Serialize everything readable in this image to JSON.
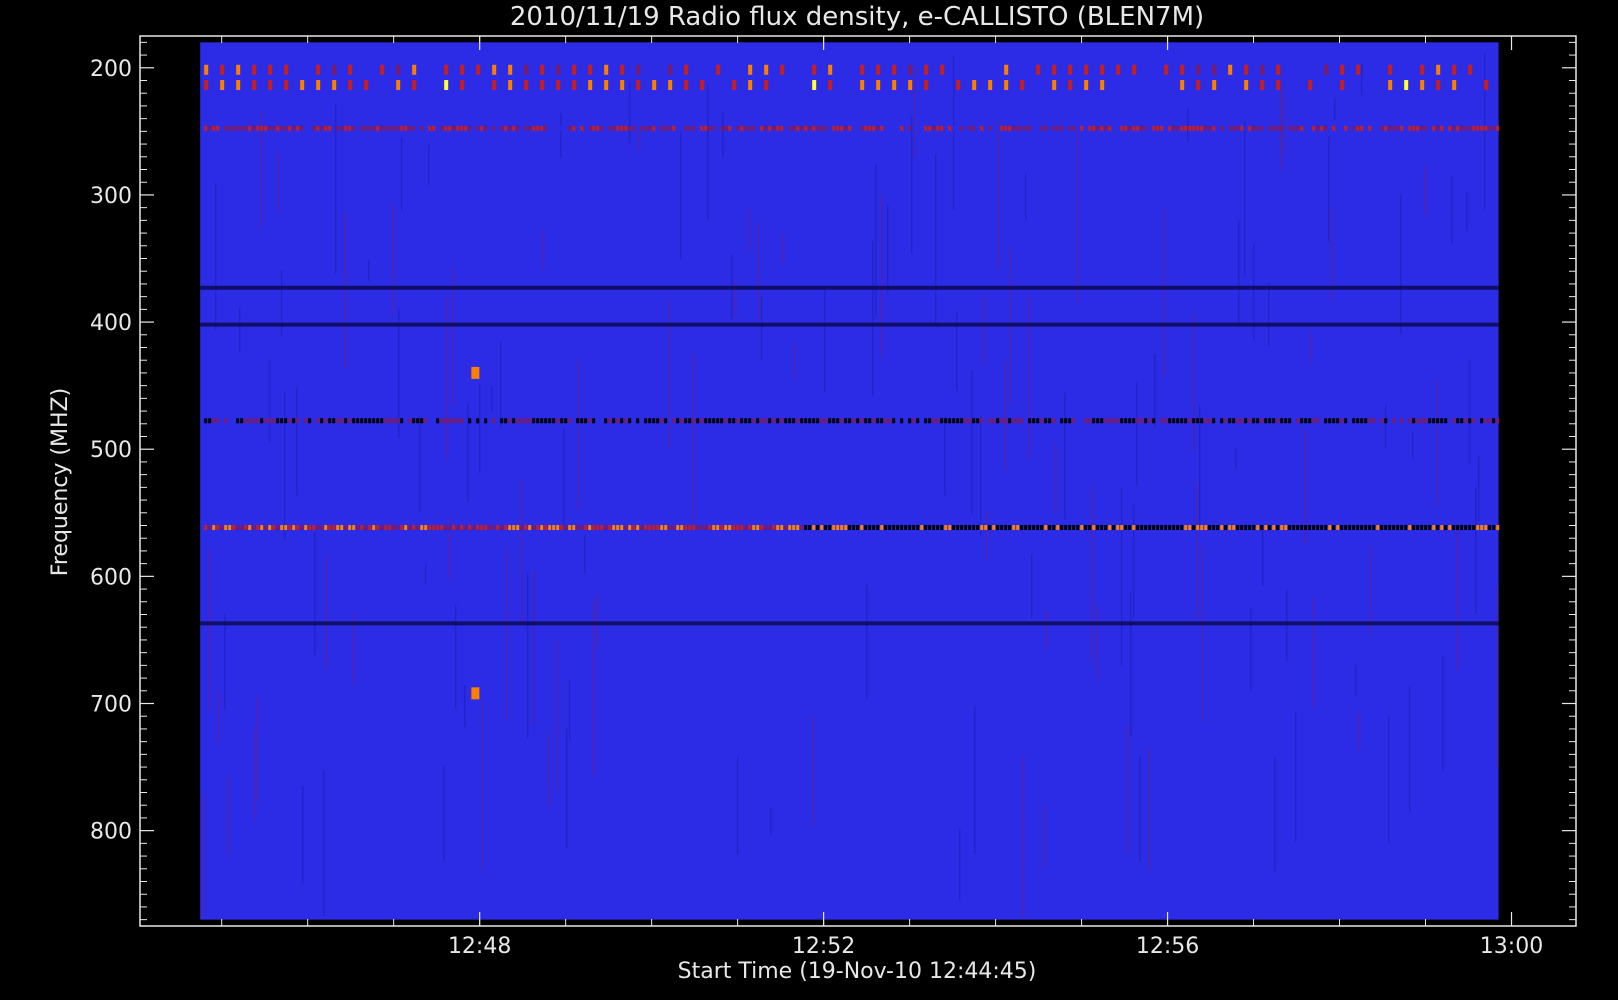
{
  "chart_data": {
    "type": "heatmap",
    "title": "2010/11/19  Radio flux density, e-CALLISTO (BLEN7M)",
    "xlabel": "Start Time (19-Nov-10 12:44:45)",
    "ylabel": "Frequency (MHZ)",
    "x_tick_labels": [
      "12:48",
      "12:52",
      "12:56",
      "13:00"
    ],
    "x_tick_minutes": [
      3.25,
      7.25,
      11.25,
      15.25
    ],
    "xlim_minutes": [
      -0.7,
      16.0
    ],
    "data_x_range_minutes": [
      0.0,
      15.1
    ],
    "y_ticks": [
      200,
      300,
      400,
      500,
      600,
      700,
      800
    ],
    "ylim": [
      175,
      875
    ],
    "data_y_range": [
      180,
      870
    ],
    "y_inverted": true,
    "colormap": [
      "#000000",
      "#1a1aa8",
      "#2c2ce6",
      "#7a1a6a",
      "#c81e1e",
      "#ff8000",
      "#ffff40"
    ],
    "background_level_color": "#2c2ce6",
    "features": [
      {
        "freq_mhz": 200,
        "kind": "bursts",
        "intensity": 0.8
      },
      {
        "freq_mhz": 212,
        "kind": "bursts",
        "intensity": 0.95
      },
      {
        "freq_mhz": 248,
        "kind": "line",
        "intensity": 0.7
      },
      {
        "freq_mhz": 373,
        "kind": "dark-line",
        "intensity": 0.0
      },
      {
        "freq_mhz": 402,
        "kind": "dark-line",
        "intensity": 0.1
      },
      {
        "freq_mhz": 478,
        "kind": "mixed-line",
        "intensity": 0.5
      },
      {
        "freq_mhz": 562,
        "kind": "line",
        "intensity": 0.9
      },
      {
        "freq_mhz": 637,
        "kind": "dark-line",
        "intensity": 0.1
      },
      {
        "freq_mhz": 440,
        "time_min": 3.2,
        "kind": "spot",
        "intensity": 0.9
      },
      {
        "freq_mhz": 692,
        "time_min": 3.2,
        "kind": "spot",
        "intensity": 0.9
      }
    ]
  }
}
